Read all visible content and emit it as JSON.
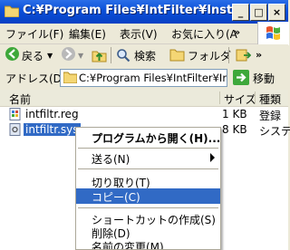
{
  "window": {
    "title": "C:¥Program Files¥IntFilter¥Install",
    "buttons": [
      "_",
      "□",
      "×"
    ]
  },
  "menu": {
    "items": [
      "ファイル(F)",
      "編集(E)",
      "表示(V)",
      "お気に入り(A"
    ],
    "overflow": "»"
  },
  "toolbar": {
    "back": "戻る",
    "search": "検索",
    "folders": "フォルダ"
  },
  "address": {
    "label": "アドレス(D)",
    "value": "C:¥Program Files¥IntFilter¥In",
    "go": "移動"
  },
  "columns": {
    "name": "名前",
    "size": "サイズ",
    "type": "種類"
  },
  "files": [
    {
      "name": "intfiltr.reg",
      "size": "1 KB",
      "type": "登録",
      "icon": "registry-file-icon"
    },
    {
      "name": "intfiltr.sys",
      "size": "8 KB",
      "type": "システ",
      "icon": "system-file-icon"
    }
  ],
  "context_menu": {
    "open_with": "プログラムから開く(H)...",
    "send_to": "送る(N)",
    "cut": "切り取り(T)",
    "copy": "コピー(C)",
    "create_shortcut": "ショートカットの作成(S)",
    "delete": "削除(D)",
    "rename": "名前の変更(M)"
  },
  "colors": {
    "title_bar": "#0a4fd8",
    "selection": "#316ac5"
  }
}
